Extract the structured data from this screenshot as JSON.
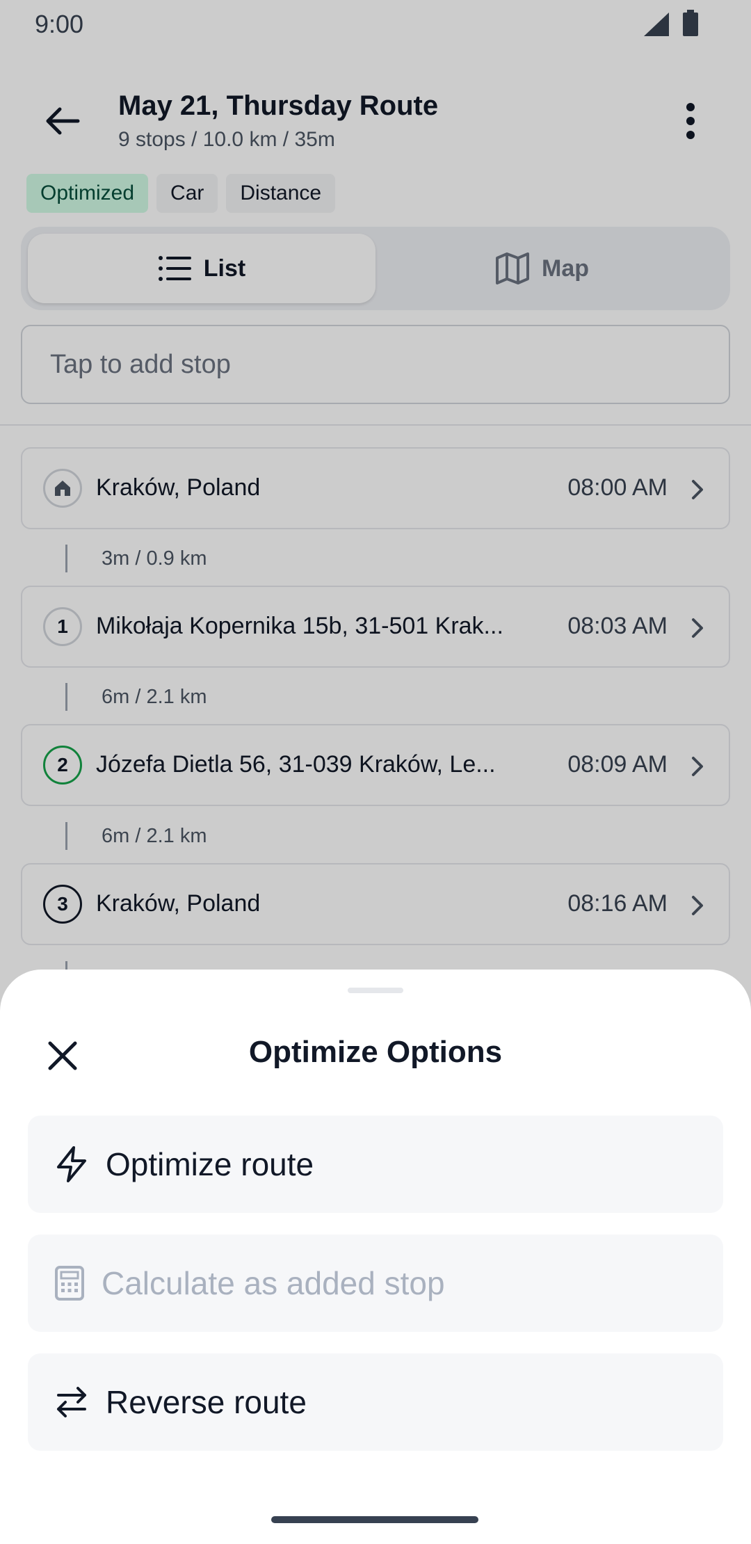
{
  "status_bar": {
    "time": "9:00"
  },
  "header": {
    "title": "May 21, Thursday Route",
    "summary": "9 stops / 10.0 km / 35m"
  },
  "chips": [
    {
      "label": "Optimized",
      "active": true
    },
    {
      "label": "Car",
      "active": false
    },
    {
      "label": "Distance",
      "active": false
    }
  ],
  "view_toggle": {
    "list_label": "List",
    "map_label": "Map",
    "selected": "List"
  },
  "add_stop": {
    "placeholder": "Tap to add stop"
  },
  "stops": [
    {
      "marker": "home-icon",
      "address": "Kraków, Poland",
      "time": "08:00 AM"
    },
    {
      "marker": "1",
      "address": "Mikołaja Kopernika 15b, 31-501 Krak...",
      "time": "08:03 AM"
    },
    {
      "marker": "2",
      "address": "Józefa Dietla 56, 31-039 Kraków, Le...",
      "time": "08:09 AM"
    },
    {
      "marker": "3",
      "address": "Kraków, Poland",
      "time": "08:16 AM"
    }
  ],
  "legs": [
    {
      "text": "3m / 0.9 km"
    },
    {
      "text": "6m / 2.1 km"
    },
    {
      "text": "6m / 2.1 km"
    }
  ],
  "sheet": {
    "title": "Optimize Options",
    "options": [
      {
        "label": "Optimize route",
        "icon": "lightning-icon",
        "disabled": false
      },
      {
        "label": "Calculate as added stop",
        "icon": "calculator-icon",
        "disabled": true
      },
      {
        "label": "Reverse route",
        "icon": "swap-arrows-icon",
        "disabled": false
      }
    ]
  },
  "colors": {
    "accent_green": "#16a34a",
    "chip_active_bg": "#d1fae5",
    "scrim": "rgba(0,0,0,0.20)"
  }
}
